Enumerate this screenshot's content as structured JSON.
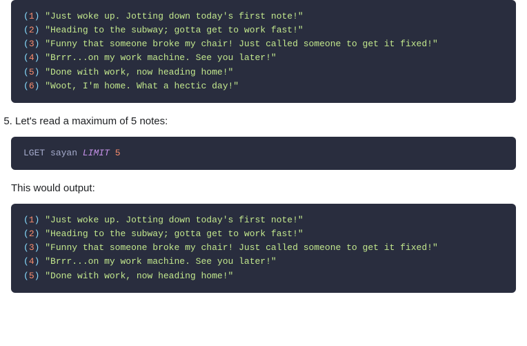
{
  "output_block_1": [
    {
      "index": "1",
      "text": "\"Just woke up. Jotting down today's first note!\""
    },
    {
      "index": "2",
      "text": "\"Heading to the subway; gotta get to work fast!\""
    },
    {
      "index": "3",
      "text": "\"Funny that someone broke my chair! Just called someone to get it fixed!\""
    },
    {
      "index": "4",
      "text": "\"Brrr...on my work machine. See you later!\""
    },
    {
      "index": "5",
      "text": "\"Done with work, now heading home!\""
    },
    {
      "index": "6",
      "text": "\"Woot, I'm home. What a hectic day!\""
    }
  ],
  "step5_text": "Let's read a maximum of 5 notes:",
  "command_block": {
    "kw": "LGET",
    "ident": "sayan",
    "limit_kw": "LIMIT",
    "limit_val": "5"
  },
  "prose_output": "This would output:",
  "output_block_2": [
    {
      "index": "1",
      "text": "\"Just woke up. Jotting down today's first note!\""
    },
    {
      "index": "2",
      "text": "\"Heading to the subway; gotta get to work fast!\""
    },
    {
      "index": "3",
      "text": "\"Funny that someone broke my chair! Just called someone to get it fixed!\""
    },
    {
      "index": "4",
      "text": "\"Brrr...on my work machine. See you later!\""
    },
    {
      "index": "5",
      "text": "\"Done with work, now heading home!\""
    }
  ]
}
